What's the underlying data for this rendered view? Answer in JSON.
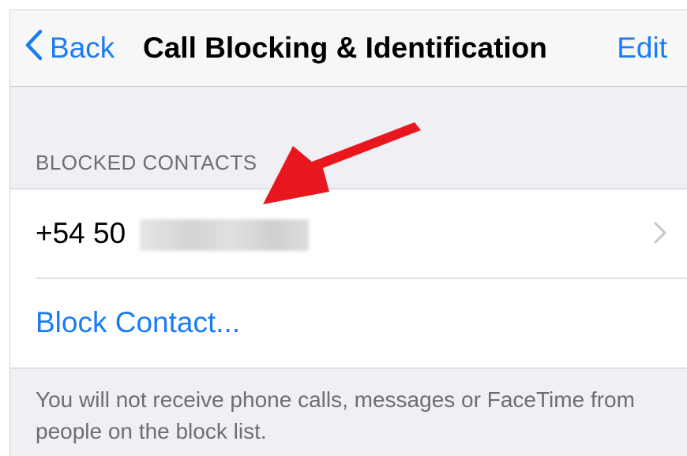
{
  "navbar": {
    "back_label": "Back",
    "title": "Call Blocking & Identification",
    "edit_label": "Edit"
  },
  "blocked_contacts": {
    "header": "BLOCKED CONTACTS",
    "items": [
      {
        "label": "+54 50"
      }
    ],
    "block_contact_label": "Block Contact..."
  },
  "footer": {
    "text": "You will not receive phone calls, messages or FaceTime from people on the block list."
  },
  "colors": {
    "accent": "#1a7cf5",
    "annotation_arrow": "#e8171e"
  },
  "icons": {
    "back": "chevron-left-icon",
    "disclosure": "chevron-right-icon",
    "annotation": "red-arrow-icon"
  }
}
